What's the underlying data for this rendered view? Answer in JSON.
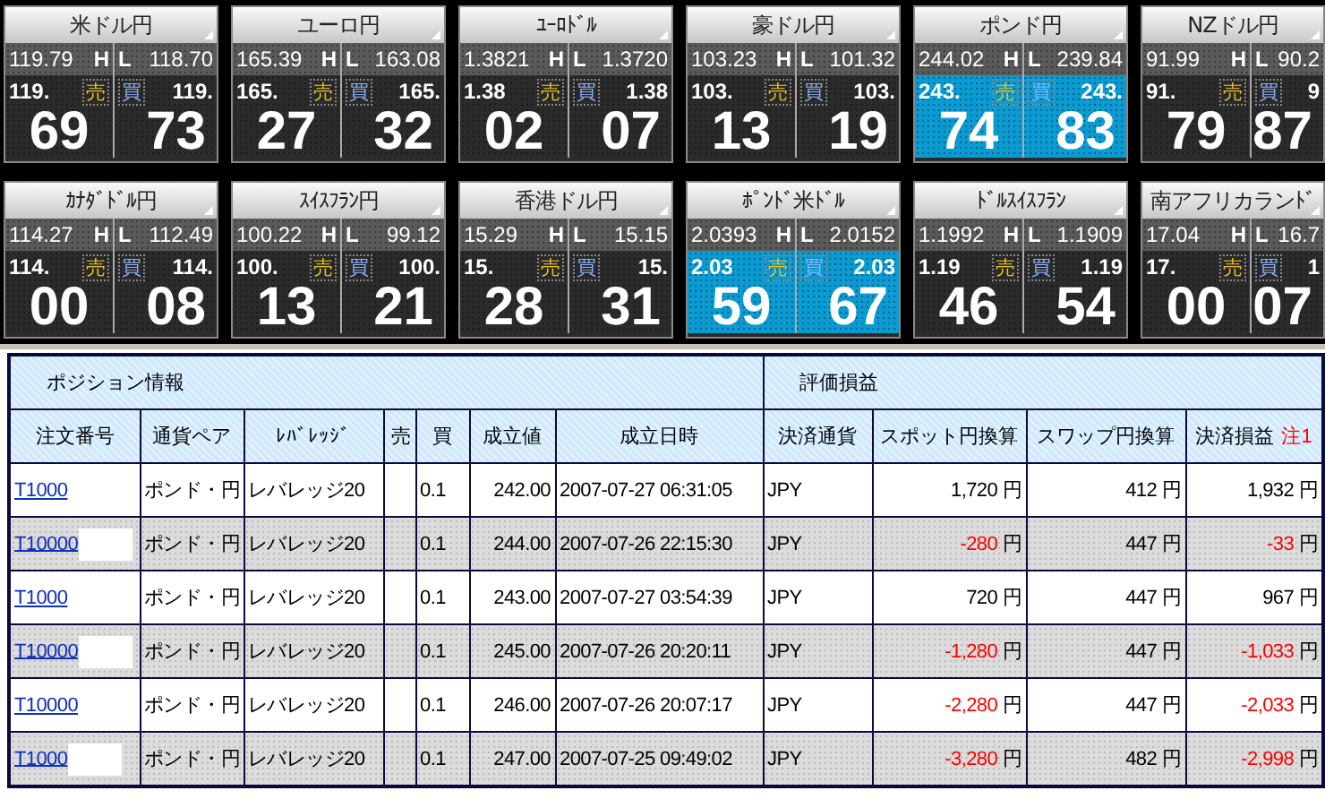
{
  "tiles": [
    {
      "title": "米ドル円",
      "high": "119.79",
      "low": "118.70",
      "h_label": "H",
      "l_label": "L",
      "sell_prefix": "119.",
      "buy_prefix": "119.",
      "sell_label": "売",
      "buy_label": "買",
      "sell_pips": "69",
      "buy_pips": "73",
      "highlighted": false
    },
    {
      "title": "ユーロ円",
      "high": "165.39",
      "low": "163.08",
      "h_label": "H",
      "l_label": "L",
      "sell_prefix": "165.",
      "buy_prefix": "165.",
      "sell_label": "売",
      "buy_label": "買",
      "sell_pips": "27",
      "buy_pips": "32",
      "highlighted": false
    },
    {
      "title": "ﾕｰﾛﾄﾞﾙ",
      "high": "1.3821",
      "low": "1.3720",
      "h_label": "H",
      "l_label": "L",
      "sell_prefix": "1.38",
      "buy_prefix": "1.38",
      "sell_label": "売",
      "buy_label": "買",
      "sell_pips": "02",
      "buy_pips": "07",
      "highlighted": false
    },
    {
      "title": "豪ドル円",
      "high": "103.23",
      "low": "101.32",
      "h_label": "H",
      "l_label": "L",
      "sell_prefix": "103.",
      "buy_prefix": "103.",
      "sell_label": "売",
      "buy_label": "買",
      "sell_pips": "13",
      "buy_pips": "19",
      "highlighted": false
    },
    {
      "title": "ポンド円",
      "high": "244.02",
      "low": "239.84",
      "h_label": "H",
      "l_label": "L",
      "sell_prefix": "243.",
      "buy_prefix": "243.",
      "sell_label": "売",
      "buy_label": "買",
      "sell_pips": "74",
      "buy_pips": "83",
      "highlighted": true
    },
    {
      "title": "NZドル円",
      "high": "91.99",
      "low": "90.2",
      "h_label": "H",
      "l_label": "L",
      "sell_prefix": "91.",
      "buy_prefix": "9",
      "sell_label": "売",
      "buy_label": "買",
      "sell_pips": "79",
      "buy_pips": "87",
      "highlighted": false
    },
    {
      "title": "ｶﾅﾀﾞﾄﾞﾙ円",
      "high": "114.27",
      "low": "112.49",
      "h_label": "H",
      "l_label": "L",
      "sell_prefix": "114.",
      "buy_prefix": "114.",
      "sell_label": "売",
      "buy_label": "買",
      "sell_pips": "00",
      "buy_pips": "08",
      "highlighted": false
    },
    {
      "title": "ｽｲｽﾌﾗﾝ円",
      "high": "100.22",
      "low": "99.12",
      "h_label": "H",
      "l_label": "L",
      "sell_prefix": "100.",
      "buy_prefix": "100.",
      "sell_label": "売",
      "buy_label": "買",
      "sell_pips": "13",
      "buy_pips": "21",
      "highlighted": false
    },
    {
      "title": "香港ドル円",
      "high": "15.29",
      "low": "15.15",
      "h_label": "H",
      "l_label": "L",
      "sell_prefix": "15.",
      "buy_prefix": "15.",
      "sell_label": "売",
      "buy_label": "買",
      "sell_pips": "28",
      "buy_pips": "31",
      "highlighted": false
    },
    {
      "title": "ﾎﾟﾝﾄﾞ米ﾄﾞﾙ",
      "high": "2.0393",
      "low": "2.0152",
      "h_label": "H",
      "l_label": "L",
      "sell_prefix": "2.03",
      "buy_prefix": "2.03",
      "sell_label": "売",
      "buy_label": "買",
      "sell_pips": "59",
      "buy_pips": "67",
      "highlighted": true
    },
    {
      "title": "ﾄﾞﾙｽｲｽﾌﾗﾝ",
      "high": "1.1992",
      "low": "1.1909",
      "h_label": "H",
      "l_label": "L",
      "sell_prefix": "1.19",
      "buy_prefix": "1.19",
      "sell_label": "売",
      "buy_label": "買",
      "sell_pips": "46",
      "buy_pips": "54",
      "highlighted": false
    },
    {
      "title": "南アフリカランﾄﾞ",
      "high": "17.04",
      "low": "16.7",
      "h_label": "H",
      "l_label": "L",
      "sell_prefix": "17.",
      "buy_prefix": "1",
      "sell_label": "売",
      "buy_label": "買",
      "sell_pips": "00",
      "buy_pips": "07",
      "highlighted": false
    }
  ],
  "positions": {
    "group_headers": [
      "ポジション情報",
      "評価損益"
    ],
    "columns": [
      {
        "label": "注文番号"
      },
      {
        "label": "通貨ペア"
      },
      {
        "label": "ﾚﾊﾞﾚｯｼﾞ"
      },
      {
        "label": "売"
      },
      {
        "label": "買"
      },
      {
        "label": "成立値"
      },
      {
        "label": "成立日時"
      },
      {
        "label": "決済通貨"
      },
      {
        "label": "スポット円換算"
      },
      {
        "label": "スワップ円換算"
      },
      {
        "label": "決済損益",
        "note": "注1"
      }
    ],
    "rows": [
      {
        "order": "T1000",
        "masked": false,
        "shaded": false,
        "pair": "ポンド・円",
        "leverage": "レバレッジ20",
        "buy": "0.1",
        "price": "242.00",
        "datetime": "2007-07-27 06:31:05",
        "currency": "JPY",
        "spot": "1,720",
        "spot_loss": false,
        "swap": "412",
        "pnl": "1,932",
        "pnl_loss": false,
        "spot_unit": "円",
        "swap_unit": "円",
        "pnl_unit": "円"
      },
      {
        "order": "T10000",
        "masked": true,
        "shaded": true,
        "pair": "ポンド・円",
        "leverage": "レバレッジ20",
        "buy": "0.1",
        "price": "244.00",
        "datetime": "2007-07-26 22:15:30",
        "currency": "JPY",
        "spot": "-280",
        "spot_loss": true,
        "swap": "447",
        "pnl": "-33",
        "pnl_loss": true,
        "spot_unit": "円",
        "swap_unit": "円",
        "pnl_unit": "円"
      },
      {
        "order": "T1000",
        "masked": false,
        "shaded": false,
        "pair": "ポンド・円",
        "leverage": "レバレッジ20",
        "buy": "0.1",
        "price": "243.00",
        "datetime": "2007-07-27 03:54:39",
        "currency": "JPY",
        "spot": "720",
        "spot_loss": false,
        "swap": "447",
        "pnl": "967",
        "pnl_loss": false,
        "spot_unit": "円",
        "swap_unit": "円",
        "pnl_unit": "円"
      },
      {
        "order": "T10000",
        "masked": true,
        "shaded": true,
        "pair": "ポンド・円",
        "leverage": "レバレッジ20",
        "buy": "0.1",
        "price": "245.00",
        "datetime": "2007-07-26 20:20:11",
        "currency": "JPY",
        "spot": "-1,280",
        "spot_loss": true,
        "swap": "447",
        "pnl": "-1,033",
        "pnl_loss": true,
        "spot_unit": "円",
        "swap_unit": "円",
        "pnl_unit": "円"
      },
      {
        "order": "T10000",
        "masked": false,
        "shaded": false,
        "pair": "ポンド・円",
        "leverage": "レバレッジ20",
        "buy": "0.1",
        "price": "246.00",
        "datetime": "2007-07-26 20:07:17",
        "currency": "JPY",
        "spot": "-2,280",
        "spot_loss": true,
        "swap": "447",
        "pnl": "-2,033",
        "pnl_loss": true,
        "spot_unit": "円",
        "swap_unit": "円",
        "pnl_unit": "円"
      },
      {
        "order": "T1000",
        "masked": true,
        "shaded": true,
        "pair": "ポンド・円",
        "leverage": "レバレッジ20",
        "buy": "0.1",
        "price": "247.00",
        "datetime": "2007-07-25 09:49:02",
        "currency": "JPY",
        "spot": "-3,280",
        "spot_loss": true,
        "swap": "482",
        "pnl": "-2,998",
        "pnl_loss": true,
        "spot_unit": "円",
        "swap_unit": "円",
        "pnl_unit": "円"
      }
    ]
  }
}
